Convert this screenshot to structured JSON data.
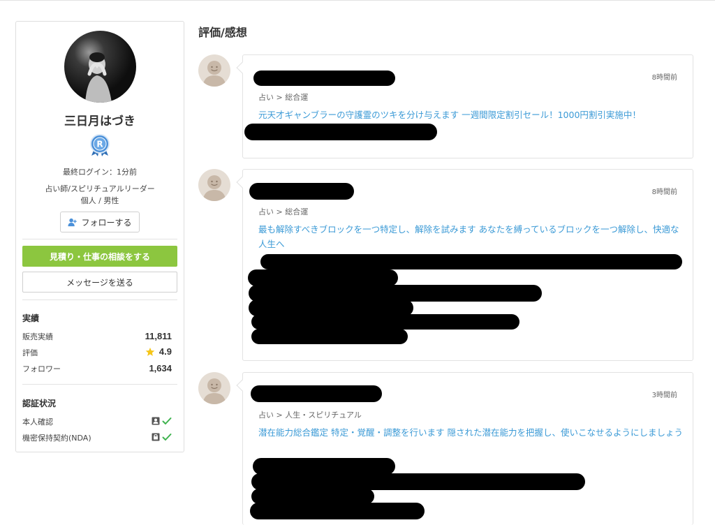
{
  "profile": {
    "name": "三日月はづき",
    "last_login": "最終ログイン：1分前",
    "role": "占い師/スピリチュアルリーダー",
    "type": "個人 /  男性",
    "follow_label": "フォローする",
    "badge_letter": "R"
  },
  "actions": {
    "consult_label": "見積り・仕事の相談をする",
    "message_label": "メッセージを送る"
  },
  "stats": {
    "title": "実績",
    "items": [
      {
        "label": "販売実績",
        "value": "11,811"
      },
      {
        "label": "評価",
        "value": "4.9"
      },
      {
        "label": "フォロワー",
        "value": "1,634"
      }
    ]
  },
  "verification": {
    "title": "認証状況",
    "items": [
      {
        "label": "本人確認",
        "icon": "id-card-icon",
        "verified": true
      },
      {
        "label": "機密保持契約(NDA)",
        "icon": "lock-icon",
        "verified": true
      }
    ]
  },
  "reviews_section": {
    "title": "評価/感想",
    "items": [
      {
        "time": "8時間前",
        "category": "占い > 総合運",
        "title": "元天才ギャンブラーの守護霊のツキを分け与えます 一週間限定割引セール！1000円割引実施中！"
      },
      {
        "time": "8時間前",
        "category": "占い > 総合運",
        "title": "最も解除すべきブロックを一つ特定し、解除を試みます あなたを縛っているブロックを一つ解除し、快適な人生へ"
      },
      {
        "time": "3時間前",
        "category": "占い > 人生・スピリチュアル",
        "title": "潜在能力総合鑑定 特定・覚醒・調整を行います 隠された潜在能力を把握し、使いこなせるようにしましょう"
      }
    ]
  },
  "colors": {
    "accent_green": "#8cc63f",
    "link_blue": "#3b9ad6",
    "star_yellow": "#f5c518",
    "check_green": "#3fb34f"
  }
}
